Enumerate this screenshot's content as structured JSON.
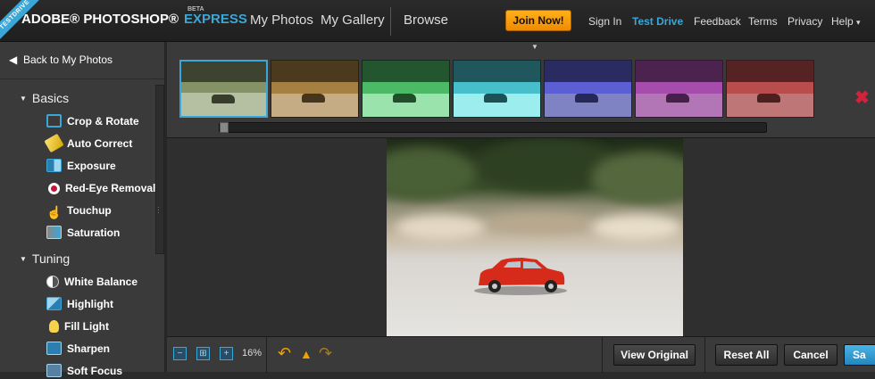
{
  "header": {
    "ribbon": "TESTDRIVE",
    "brand": "ADOBE® PHOTOSHOP®",
    "product": "EXPRESS",
    "beta": "BETA",
    "nav": [
      "My Photos",
      "My Gallery",
      "Browse"
    ],
    "join_label": "Join Now!",
    "links": [
      "Sign In",
      "Test Drive",
      "Feedback",
      "Terms",
      "Privacy",
      "Help"
    ],
    "active_link": "Test Drive",
    "help_caret": "▾"
  },
  "sidebar": {
    "back_label": "Back to My Photos",
    "sections": [
      {
        "title": "Basics",
        "items": [
          "Crop & Rotate",
          "Auto Correct",
          "Exposure",
          "Red-Eye Removal",
          "Touchup",
          "Saturation"
        ]
      },
      {
        "title": "Tuning",
        "items": [
          "White Balance",
          "Highlight",
          "Fill Light",
          "Sharpen",
          "Soft Focus"
        ]
      }
    ]
  },
  "filmstrip": {
    "thumbnails": [
      {
        "tint": "#6e7a55",
        "selected": true
      },
      {
        "tint": "#8a6a38"
      },
      {
        "tint": "#3f9a55"
      },
      {
        "tint": "#3a9fa8"
      },
      {
        "tint": "#4c4fb0"
      },
      {
        "tint": "#8a3f8f"
      },
      {
        "tint": "#9a4040"
      }
    ]
  },
  "bottombar": {
    "zoom": "16%",
    "view_original": "View Original",
    "reset_all": "Reset All",
    "cancel": "Cancel",
    "save": "Sa"
  },
  "colors": {
    "accent": "#3aa7d8",
    "join": "#f5a000",
    "close": "#d3233c"
  }
}
